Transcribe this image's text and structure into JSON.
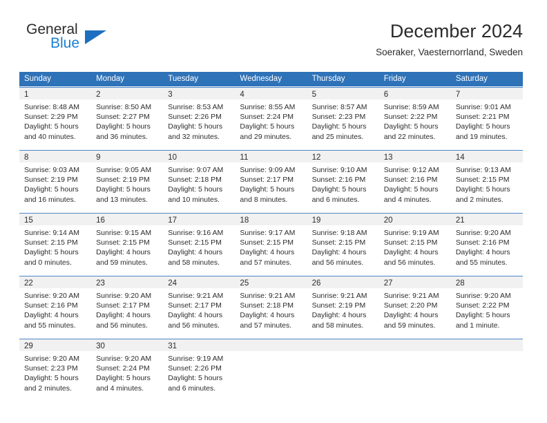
{
  "brand": {
    "name_part1": "General",
    "name_part2": "Blue",
    "logo_icon": "triangle-logo-icon"
  },
  "header": {
    "title": "December 2024",
    "location": "Soeraker, Vaesternorrland, Sweden"
  },
  "colors": {
    "header_blue": "#2e72b8",
    "brand_blue": "#1a7fd4",
    "daynum_band": "#f1f1f1",
    "row_rule": "#4a86c5",
    "text": "#2b2b2b"
  },
  "weekdays": [
    "Sunday",
    "Monday",
    "Tuesday",
    "Wednesday",
    "Thursday",
    "Friday",
    "Saturday"
  ],
  "weeks": [
    [
      {
        "day": "1",
        "sunrise": "Sunrise: 8:48 AM",
        "sunset": "Sunset: 2:29 PM",
        "daylight1": "Daylight: 5 hours",
        "daylight2": "and 40 minutes."
      },
      {
        "day": "2",
        "sunrise": "Sunrise: 8:50 AM",
        "sunset": "Sunset: 2:27 PM",
        "daylight1": "Daylight: 5 hours",
        "daylight2": "and 36 minutes."
      },
      {
        "day": "3",
        "sunrise": "Sunrise: 8:53 AM",
        "sunset": "Sunset: 2:26 PM",
        "daylight1": "Daylight: 5 hours",
        "daylight2": "and 32 minutes."
      },
      {
        "day": "4",
        "sunrise": "Sunrise: 8:55 AM",
        "sunset": "Sunset: 2:24 PM",
        "daylight1": "Daylight: 5 hours",
        "daylight2": "and 29 minutes."
      },
      {
        "day": "5",
        "sunrise": "Sunrise: 8:57 AM",
        "sunset": "Sunset: 2:23 PM",
        "daylight1": "Daylight: 5 hours",
        "daylight2": "and 25 minutes."
      },
      {
        "day": "6",
        "sunrise": "Sunrise: 8:59 AM",
        "sunset": "Sunset: 2:22 PM",
        "daylight1": "Daylight: 5 hours",
        "daylight2": "and 22 minutes."
      },
      {
        "day": "7",
        "sunrise": "Sunrise: 9:01 AM",
        "sunset": "Sunset: 2:21 PM",
        "daylight1": "Daylight: 5 hours",
        "daylight2": "and 19 minutes."
      }
    ],
    [
      {
        "day": "8",
        "sunrise": "Sunrise: 9:03 AM",
        "sunset": "Sunset: 2:19 PM",
        "daylight1": "Daylight: 5 hours",
        "daylight2": "and 16 minutes."
      },
      {
        "day": "9",
        "sunrise": "Sunrise: 9:05 AM",
        "sunset": "Sunset: 2:19 PM",
        "daylight1": "Daylight: 5 hours",
        "daylight2": "and 13 minutes."
      },
      {
        "day": "10",
        "sunrise": "Sunrise: 9:07 AM",
        "sunset": "Sunset: 2:18 PM",
        "daylight1": "Daylight: 5 hours",
        "daylight2": "and 10 minutes."
      },
      {
        "day": "11",
        "sunrise": "Sunrise: 9:09 AM",
        "sunset": "Sunset: 2:17 PM",
        "daylight1": "Daylight: 5 hours",
        "daylight2": "and 8 minutes."
      },
      {
        "day": "12",
        "sunrise": "Sunrise: 9:10 AM",
        "sunset": "Sunset: 2:16 PM",
        "daylight1": "Daylight: 5 hours",
        "daylight2": "and 6 minutes."
      },
      {
        "day": "13",
        "sunrise": "Sunrise: 9:12 AM",
        "sunset": "Sunset: 2:16 PM",
        "daylight1": "Daylight: 5 hours",
        "daylight2": "and 4 minutes."
      },
      {
        "day": "14",
        "sunrise": "Sunrise: 9:13 AM",
        "sunset": "Sunset: 2:15 PM",
        "daylight1": "Daylight: 5 hours",
        "daylight2": "and 2 minutes."
      }
    ],
    [
      {
        "day": "15",
        "sunrise": "Sunrise: 9:14 AM",
        "sunset": "Sunset: 2:15 PM",
        "daylight1": "Daylight: 5 hours",
        "daylight2": "and 0 minutes."
      },
      {
        "day": "16",
        "sunrise": "Sunrise: 9:15 AM",
        "sunset": "Sunset: 2:15 PM",
        "daylight1": "Daylight: 4 hours",
        "daylight2": "and 59 minutes."
      },
      {
        "day": "17",
        "sunrise": "Sunrise: 9:16 AM",
        "sunset": "Sunset: 2:15 PM",
        "daylight1": "Daylight: 4 hours",
        "daylight2": "and 58 minutes."
      },
      {
        "day": "18",
        "sunrise": "Sunrise: 9:17 AM",
        "sunset": "Sunset: 2:15 PM",
        "daylight1": "Daylight: 4 hours",
        "daylight2": "and 57 minutes."
      },
      {
        "day": "19",
        "sunrise": "Sunrise: 9:18 AM",
        "sunset": "Sunset: 2:15 PM",
        "daylight1": "Daylight: 4 hours",
        "daylight2": "and 56 minutes."
      },
      {
        "day": "20",
        "sunrise": "Sunrise: 9:19 AM",
        "sunset": "Sunset: 2:15 PM",
        "daylight1": "Daylight: 4 hours",
        "daylight2": "and 56 minutes."
      },
      {
        "day": "21",
        "sunrise": "Sunrise: 9:20 AM",
        "sunset": "Sunset: 2:16 PM",
        "daylight1": "Daylight: 4 hours",
        "daylight2": "and 55 minutes."
      }
    ],
    [
      {
        "day": "22",
        "sunrise": "Sunrise: 9:20 AM",
        "sunset": "Sunset: 2:16 PM",
        "daylight1": "Daylight: 4 hours",
        "daylight2": "and 55 minutes."
      },
      {
        "day": "23",
        "sunrise": "Sunrise: 9:20 AM",
        "sunset": "Sunset: 2:17 PM",
        "daylight1": "Daylight: 4 hours",
        "daylight2": "and 56 minutes."
      },
      {
        "day": "24",
        "sunrise": "Sunrise: 9:21 AM",
        "sunset": "Sunset: 2:17 PM",
        "daylight1": "Daylight: 4 hours",
        "daylight2": "and 56 minutes."
      },
      {
        "day": "25",
        "sunrise": "Sunrise: 9:21 AM",
        "sunset": "Sunset: 2:18 PM",
        "daylight1": "Daylight: 4 hours",
        "daylight2": "and 57 minutes."
      },
      {
        "day": "26",
        "sunrise": "Sunrise: 9:21 AM",
        "sunset": "Sunset: 2:19 PM",
        "daylight1": "Daylight: 4 hours",
        "daylight2": "and 58 minutes."
      },
      {
        "day": "27",
        "sunrise": "Sunrise: 9:21 AM",
        "sunset": "Sunset: 2:20 PM",
        "daylight1": "Daylight: 4 hours",
        "daylight2": "and 59 minutes."
      },
      {
        "day": "28",
        "sunrise": "Sunrise: 9:20 AM",
        "sunset": "Sunset: 2:22 PM",
        "daylight1": "Daylight: 5 hours",
        "daylight2": "and 1 minute."
      }
    ],
    [
      {
        "day": "29",
        "sunrise": "Sunrise: 9:20 AM",
        "sunset": "Sunset: 2:23 PM",
        "daylight1": "Daylight: 5 hours",
        "daylight2": "and 2 minutes."
      },
      {
        "day": "30",
        "sunrise": "Sunrise: 9:20 AM",
        "sunset": "Sunset: 2:24 PM",
        "daylight1": "Daylight: 5 hours",
        "daylight2": "and 4 minutes."
      },
      {
        "day": "31",
        "sunrise": "Sunrise: 9:19 AM",
        "sunset": "Sunset: 2:26 PM",
        "daylight1": "Daylight: 5 hours",
        "daylight2": "and 6 minutes."
      },
      {
        "day": "",
        "sunrise": "",
        "sunset": "",
        "daylight1": "",
        "daylight2": ""
      },
      {
        "day": "",
        "sunrise": "",
        "sunset": "",
        "daylight1": "",
        "daylight2": ""
      },
      {
        "day": "",
        "sunrise": "",
        "sunset": "",
        "daylight1": "",
        "daylight2": ""
      },
      {
        "day": "",
        "sunrise": "",
        "sunset": "",
        "daylight1": "",
        "daylight2": ""
      }
    ]
  ]
}
